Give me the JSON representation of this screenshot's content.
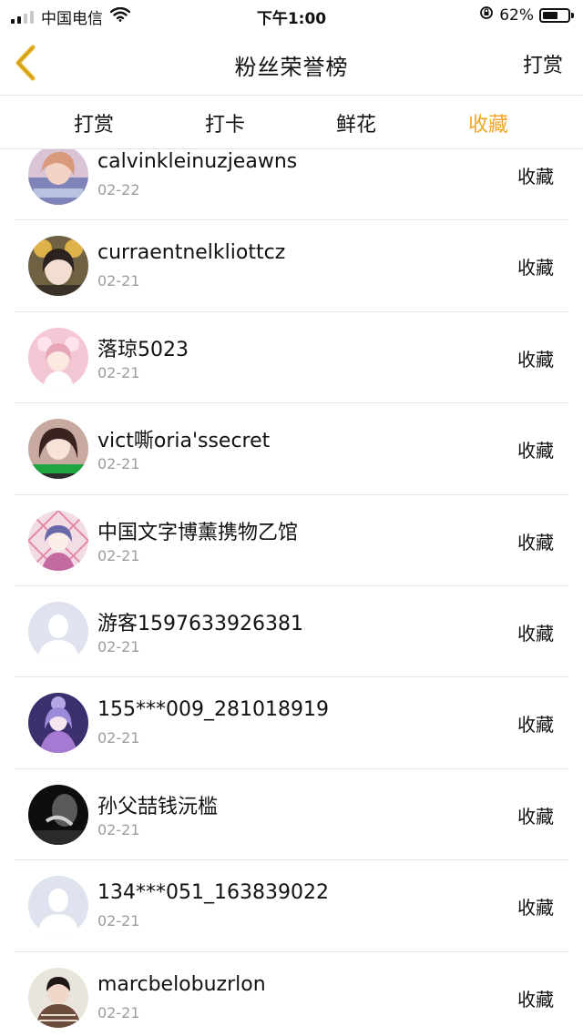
{
  "status_bar": {
    "carrier": "中国电信",
    "time": "下午1:00",
    "battery": "62%",
    "battery_level": 0.62
  },
  "header": {
    "back_icon": "chevron-left-icon",
    "title": "粉丝荣誉榜",
    "action_label": "打赏"
  },
  "tabs": [
    {
      "label": "打赏",
      "active": false
    },
    {
      "label": "打卡",
      "active": false
    },
    {
      "label": "鲜花",
      "active": false
    },
    {
      "label": "收藏",
      "active": true
    }
  ],
  "colors": {
    "accent": "#f0a628",
    "back_icon": "#e8b423"
  },
  "entries": [
    {
      "name": "calvinkleinuzjeawns",
      "date": "02-22",
      "type": "收藏",
      "avatar": "photo"
    },
    {
      "name": "curraentnelkliottcz",
      "date": "02-21",
      "type": "收藏",
      "avatar": "photo"
    },
    {
      "name": "落琼5023",
      "date": "02-21",
      "type": "收藏",
      "avatar": "photo"
    },
    {
      "name": "vict嘶oria'ssecret",
      "date": "02-21",
      "type": "收藏",
      "avatar": "photo"
    },
    {
      "name": "中国文字博薰携物乙馆",
      "date": "02-21",
      "type": "收藏",
      "avatar": "photo"
    },
    {
      "name": "游客1597633926381",
      "date": "02-21",
      "type": "收藏",
      "avatar": "default"
    },
    {
      "name": "155***009_281018919",
      "date": "02-21",
      "type": "收藏",
      "avatar": "photo"
    },
    {
      "name": "孙父喆钱沅槛",
      "date": "02-21",
      "type": "收藏",
      "avatar": "photo"
    },
    {
      "name": "134***051_163839022",
      "date": "02-21",
      "type": "收藏",
      "avatar": "default"
    },
    {
      "name": "marcbelobuzrlon",
      "date": "02-21",
      "type": "收藏",
      "avatar": "photo"
    }
  ]
}
